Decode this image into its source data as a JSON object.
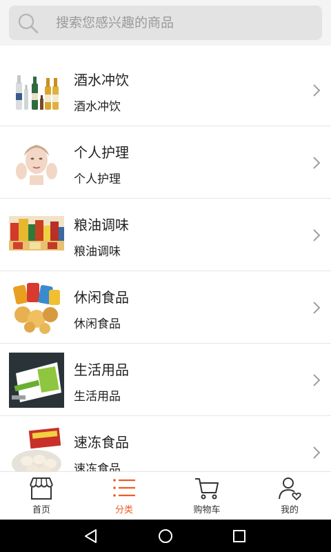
{
  "search": {
    "placeholder": "搜索您感兴趣的商品",
    "icon": "search-icon"
  },
  "categories": [
    {
      "title": "酒水冲饮",
      "subtitle": "酒水冲饮",
      "icon": "chevron-right-icon"
    },
    {
      "title": "个人护理",
      "subtitle": "个人护理",
      "icon": "chevron-right-icon"
    },
    {
      "title": "粮油调味",
      "subtitle": "粮油调味",
      "icon": "chevron-right-icon"
    },
    {
      "title": "休闲食品",
      "subtitle": "休闲食品",
      "icon": "chevron-right-icon"
    },
    {
      "title": "生活用品",
      "subtitle": "生活用品",
      "icon": "chevron-right-icon"
    },
    {
      "title": "速冻食品",
      "subtitle": "速冻食品",
      "icon": "chevron-right-icon"
    }
  ],
  "tabs": [
    {
      "label": "首页",
      "icon": "store-icon",
      "active": false
    },
    {
      "label": "分类",
      "icon": "list-icon",
      "active": true
    },
    {
      "label": "购物车",
      "icon": "cart-icon",
      "active": false
    },
    {
      "label": "我的",
      "icon": "user-heart-icon",
      "active": false
    }
  ],
  "colors": {
    "accent": "#f05a24",
    "text": "#222222",
    "placeholder": "#9a9a9a",
    "search_bg": "#e3e3e3",
    "nav_bar": "#000000"
  },
  "system_nav": [
    "back-icon",
    "home-icon",
    "recents-icon"
  ]
}
